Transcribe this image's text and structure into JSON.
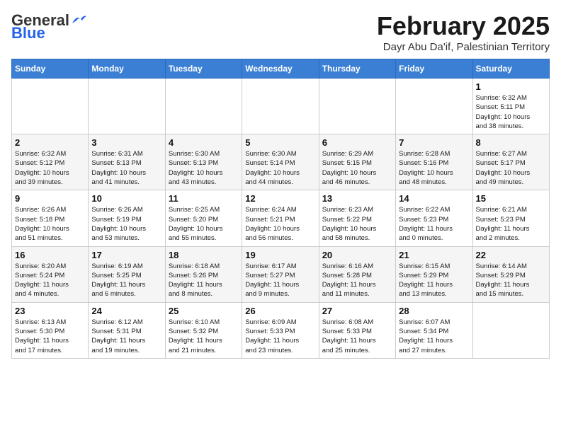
{
  "header": {
    "logo_general": "General",
    "logo_blue": "Blue",
    "month_title": "February 2025",
    "location": "Dayr Abu Da'if, Palestinian Territory"
  },
  "days_of_week": [
    "Sunday",
    "Monday",
    "Tuesday",
    "Wednesday",
    "Thursday",
    "Friday",
    "Saturday"
  ],
  "weeks": [
    [
      {
        "day": "",
        "info": ""
      },
      {
        "day": "",
        "info": ""
      },
      {
        "day": "",
        "info": ""
      },
      {
        "day": "",
        "info": ""
      },
      {
        "day": "",
        "info": ""
      },
      {
        "day": "",
        "info": ""
      },
      {
        "day": "1",
        "info": "Sunrise: 6:32 AM\nSunset: 5:11 PM\nDaylight: 10 hours\nand 38 minutes."
      }
    ],
    [
      {
        "day": "2",
        "info": "Sunrise: 6:32 AM\nSunset: 5:12 PM\nDaylight: 10 hours\nand 39 minutes."
      },
      {
        "day": "3",
        "info": "Sunrise: 6:31 AM\nSunset: 5:13 PM\nDaylight: 10 hours\nand 41 minutes."
      },
      {
        "day": "4",
        "info": "Sunrise: 6:30 AM\nSunset: 5:13 PM\nDaylight: 10 hours\nand 43 minutes."
      },
      {
        "day": "5",
        "info": "Sunrise: 6:30 AM\nSunset: 5:14 PM\nDaylight: 10 hours\nand 44 minutes."
      },
      {
        "day": "6",
        "info": "Sunrise: 6:29 AM\nSunset: 5:15 PM\nDaylight: 10 hours\nand 46 minutes."
      },
      {
        "day": "7",
        "info": "Sunrise: 6:28 AM\nSunset: 5:16 PM\nDaylight: 10 hours\nand 48 minutes."
      },
      {
        "day": "8",
        "info": "Sunrise: 6:27 AM\nSunset: 5:17 PM\nDaylight: 10 hours\nand 49 minutes."
      }
    ],
    [
      {
        "day": "9",
        "info": "Sunrise: 6:26 AM\nSunset: 5:18 PM\nDaylight: 10 hours\nand 51 minutes."
      },
      {
        "day": "10",
        "info": "Sunrise: 6:26 AM\nSunset: 5:19 PM\nDaylight: 10 hours\nand 53 minutes."
      },
      {
        "day": "11",
        "info": "Sunrise: 6:25 AM\nSunset: 5:20 PM\nDaylight: 10 hours\nand 55 minutes."
      },
      {
        "day": "12",
        "info": "Sunrise: 6:24 AM\nSunset: 5:21 PM\nDaylight: 10 hours\nand 56 minutes."
      },
      {
        "day": "13",
        "info": "Sunrise: 6:23 AM\nSunset: 5:22 PM\nDaylight: 10 hours\nand 58 minutes."
      },
      {
        "day": "14",
        "info": "Sunrise: 6:22 AM\nSunset: 5:23 PM\nDaylight: 11 hours\nand 0 minutes."
      },
      {
        "day": "15",
        "info": "Sunrise: 6:21 AM\nSunset: 5:23 PM\nDaylight: 11 hours\nand 2 minutes."
      }
    ],
    [
      {
        "day": "16",
        "info": "Sunrise: 6:20 AM\nSunset: 5:24 PM\nDaylight: 11 hours\nand 4 minutes."
      },
      {
        "day": "17",
        "info": "Sunrise: 6:19 AM\nSunset: 5:25 PM\nDaylight: 11 hours\nand 6 minutes."
      },
      {
        "day": "18",
        "info": "Sunrise: 6:18 AM\nSunset: 5:26 PM\nDaylight: 11 hours\nand 8 minutes."
      },
      {
        "day": "19",
        "info": "Sunrise: 6:17 AM\nSunset: 5:27 PM\nDaylight: 11 hours\nand 9 minutes."
      },
      {
        "day": "20",
        "info": "Sunrise: 6:16 AM\nSunset: 5:28 PM\nDaylight: 11 hours\nand 11 minutes."
      },
      {
        "day": "21",
        "info": "Sunrise: 6:15 AM\nSunset: 5:29 PM\nDaylight: 11 hours\nand 13 minutes."
      },
      {
        "day": "22",
        "info": "Sunrise: 6:14 AM\nSunset: 5:29 PM\nDaylight: 11 hours\nand 15 minutes."
      }
    ],
    [
      {
        "day": "23",
        "info": "Sunrise: 6:13 AM\nSunset: 5:30 PM\nDaylight: 11 hours\nand 17 minutes."
      },
      {
        "day": "24",
        "info": "Sunrise: 6:12 AM\nSunset: 5:31 PM\nDaylight: 11 hours\nand 19 minutes."
      },
      {
        "day": "25",
        "info": "Sunrise: 6:10 AM\nSunset: 5:32 PM\nDaylight: 11 hours\nand 21 minutes."
      },
      {
        "day": "26",
        "info": "Sunrise: 6:09 AM\nSunset: 5:33 PM\nDaylight: 11 hours\nand 23 minutes."
      },
      {
        "day": "27",
        "info": "Sunrise: 6:08 AM\nSunset: 5:33 PM\nDaylight: 11 hours\nand 25 minutes."
      },
      {
        "day": "28",
        "info": "Sunrise: 6:07 AM\nSunset: 5:34 PM\nDaylight: 11 hours\nand 27 minutes."
      },
      {
        "day": "",
        "info": ""
      }
    ]
  ]
}
